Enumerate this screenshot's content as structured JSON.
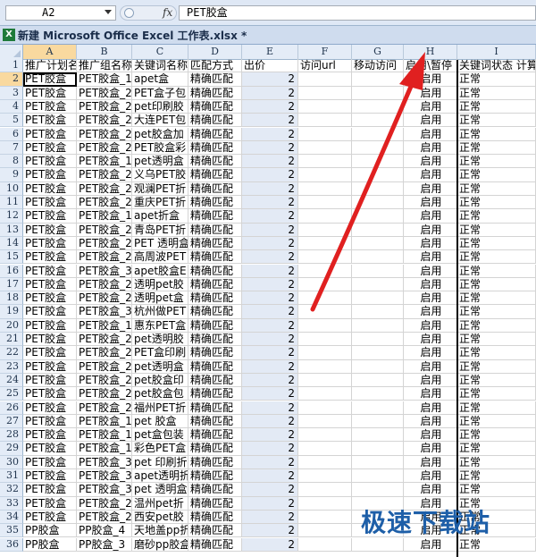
{
  "formula_bar": {
    "name_box": "A2",
    "fx_label": "fx",
    "formula": "PET胶盒"
  },
  "title_bar": {
    "app_icon": "excel-icon",
    "icon_letter": "X",
    "title": "新建 Microsoft Office Excel 工作表.xlsx *"
  },
  "sheet": {
    "columns": [
      "A",
      "B",
      "C",
      "D",
      "E",
      "F",
      "G",
      "H",
      "I"
    ],
    "selected_cell": "A2",
    "header_row": {
      "num": "1",
      "cells": [
        "推广计划名",
        "推广组名称",
        "关键词名称",
        "匹配方式",
        "出价",
        "访问url",
        "移动访问",
        "启用\\暂停",
        "关键词状态 计算"
      ]
    },
    "rows": [
      {
        "num": "2",
        "cells": [
          "PET胶盒",
          "PET胶盒_1",
          "apet盒",
          "精确匹配",
          "2",
          "",
          "",
          "启用",
          "正常"
        ]
      },
      {
        "num": "3",
        "cells": [
          "PET胶盒",
          "PET胶盒_2",
          "PET盒子包",
          "精确匹配",
          "2",
          "",
          "",
          "启用",
          "正常"
        ]
      },
      {
        "num": "4",
        "cells": [
          "PET胶盒",
          "PET胶盒_2",
          "pet印刷胶",
          "精确匹配",
          "2",
          "",
          "",
          "启用",
          "正常"
        ]
      },
      {
        "num": "5",
        "cells": [
          "PET胶盒",
          "PET胶盒_2",
          "大连PET包",
          "精确匹配",
          "2",
          "",
          "",
          "启用",
          "正常"
        ]
      },
      {
        "num": "6",
        "cells": [
          "PET胶盒",
          "PET胶盒_2",
          "pet胶盒加",
          "精确匹配",
          "2",
          "",
          "",
          "启用",
          "正常"
        ]
      },
      {
        "num": "7",
        "cells": [
          "PET胶盒",
          "PET胶盒_2",
          "PET胶盒彩",
          "精确匹配",
          "2",
          "",
          "",
          "启用",
          "正常"
        ]
      },
      {
        "num": "8",
        "cells": [
          "PET胶盒",
          "PET胶盒_1",
          "pet透明盒",
          "精确匹配",
          "2",
          "",
          "",
          "启用",
          "正常"
        ]
      },
      {
        "num": "9",
        "cells": [
          "PET胶盒",
          "PET胶盒_2",
          "义乌PET胶",
          "精确匹配",
          "2",
          "",
          "",
          "启用",
          "正常"
        ]
      },
      {
        "num": "10",
        "cells": [
          "PET胶盒",
          "PET胶盒_2",
          "观澜PET折",
          "精确匹配",
          "2",
          "",
          "",
          "启用",
          "正常"
        ]
      },
      {
        "num": "11",
        "cells": [
          "PET胶盒",
          "PET胶盒_2",
          "重庆PET折",
          "精确匹配",
          "2",
          "",
          "",
          "启用",
          "正常"
        ]
      },
      {
        "num": "12",
        "cells": [
          "PET胶盒",
          "PET胶盒_1",
          "apet折盒",
          "精确匹配",
          "2",
          "",
          "",
          "启用",
          "正常"
        ]
      },
      {
        "num": "13",
        "cells": [
          "PET胶盒",
          "PET胶盒_2",
          "青岛PET折",
          "精确匹配",
          "2",
          "",
          "",
          "启用",
          "正常"
        ]
      },
      {
        "num": "14",
        "cells": [
          "PET胶盒",
          "PET胶盒_2",
          "PET 透明盒",
          "精确匹配",
          "2",
          "",
          "",
          "启用",
          "正常"
        ]
      },
      {
        "num": "15",
        "cells": [
          "PET胶盒",
          "PET胶盒_2",
          "高周波PET",
          "精确匹配",
          "2",
          "",
          "",
          "启用",
          "正常"
        ]
      },
      {
        "num": "16",
        "cells": [
          "PET胶盒",
          "PET胶盒_3",
          "apet胶盒E",
          "精确匹配",
          "2",
          "",
          "",
          "启用",
          "正常"
        ]
      },
      {
        "num": "17",
        "cells": [
          "PET胶盒",
          "PET胶盒_2",
          "透明pet胶",
          "精确匹配",
          "2",
          "",
          "",
          "启用",
          "正常"
        ]
      },
      {
        "num": "18",
        "cells": [
          "PET胶盒",
          "PET胶盒_2",
          "透明pet盒",
          "精确匹配",
          "2",
          "",
          "",
          "启用",
          "正常"
        ]
      },
      {
        "num": "19",
        "cells": [
          "PET胶盒",
          "PET胶盒_3",
          "杭州做PET",
          "精确匹配",
          "2",
          "",
          "",
          "启用",
          "正常"
        ]
      },
      {
        "num": "20",
        "cells": [
          "PET胶盒",
          "PET胶盒_1",
          "惠东PET盒",
          "精确匹配",
          "2",
          "",
          "",
          "启用",
          "正常"
        ]
      },
      {
        "num": "21",
        "cells": [
          "PET胶盒",
          "PET胶盒_2",
          "pet透明胶",
          "精确匹配",
          "2",
          "",
          "",
          "启用",
          "正常"
        ]
      },
      {
        "num": "22",
        "cells": [
          "PET胶盒",
          "PET胶盒_2",
          "PET盒印刷",
          "精确匹配",
          "2",
          "",
          "",
          "启用",
          "正常"
        ]
      },
      {
        "num": "23",
        "cells": [
          "PET胶盒",
          "PET胶盒_2",
          "pet透明盒",
          "精确匹配",
          "2",
          "",
          "",
          "启用",
          "正常"
        ]
      },
      {
        "num": "24",
        "cells": [
          "PET胶盒",
          "PET胶盒_2",
          "pet胶盒印",
          "精确匹配",
          "2",
          "",
          "",
          "启用",
          "正常"
        ]
      },
      {
        "num": "25",
        "cells": [
          "PET胶盒",
          "PET胶盒_2",
          "pet胶盒包",
          "精确匹配",
          "2",
          "",
          "",
          "启用",
          "正常"
        ]
      },
      {
        "num": "26",
        "cells": [
          "PET胶盒",
          "PET胶盒_2",
          "福州PET折",
          "精确匹配",
          "2",
          "",
          "",
          "启用",
          "正常"
        ]
      },
      {
        "num": "27",
        "cells": [
          "PET胶盒",
          "PET胶盒_1",
          "pet 胶盒",
          "精确匹配",
          "2",
          "",
          "",
          "启用",
          "正常"
        ]
      },
      {
        "num": "28",
        "cells": [
          "PET胶盒",
          "PET胶盒_1",
          "pet盒包装",
          "精确匹配",
          "2",
          "",
          "",
          "启用",
          "正常"
        ]
      },
      {
        "num": "29",
        "cells": [
          "PET胶盒",
          "PET胶盒_1",
          "彩色PET盒",
          "精确匹配",
          "2",
          "",
          "",
          "启用",
          "正常"
        ]
      },
      {
        "num": "30",
        "cells": [
          "PET胶盒",
          "PET胶盒_3",
          "pet 印刷折",
          "精确匹配",
          "2",
          "",
          "",
          "启用",
          "正常"
        ]
      },
      {
        "num": "31",
        "cells": [
          "PET胶盒",
          "PET胶盒_3",
          "apet透明折",
          "精确匹配",
          "2",
          "",
          "",
          "启用",
          "正常"
        ]
      },
      {
        "num": "32",
        "cells": [
          "PET胶盒",
          "PET胶盒_3",
          "pet 透明盒",
          "精确匹配",
          "2",
          "",
          "",
          "启用",
          "正常"
        ]
      },
      {
        "num": "33",
        "cells": [
          "PET胶盒",
          "PET胶盒_2",
          "温州pet折",
          "精确匹配",
          "2",
          "",
          "",
          "启用",
          "正常"
        ]
      },
      {
        "num": "34",
        "cells": [
          "PET胶盒",
          "PET胶盒_2",
          "西安pet胶",
          "精确匹配",
          "2",
          "",
          "",
          "启用",
          "正常"
        ]
      },
      {
        "num": "35",
        "cells": [
          "PP胶盒",
          "PP胶盒_4",
          "天地盖pp折",
          "精确匹配",
          "2",
          "",
          "",
          "启用",
          "正常"
        ]
      },
      {
        "num": "36",
        "cells": [
          "PP胶盒",
          "PP胶盒_3",
          "磨砂pp胶盒",
          "精确匹配",
          "2",
          "",
          "",
          "启用",
          "正常"
        ]
      }
    ]
  },
  "watermark": "极速下载站",
  "colors": {
    "annotation_arrow": "#e02020",
    "header_bg": "#e4ecf7",
    "selected_header": "#f9d99f",
    "column_e_fill": "#e3eaf5"
  }
}
